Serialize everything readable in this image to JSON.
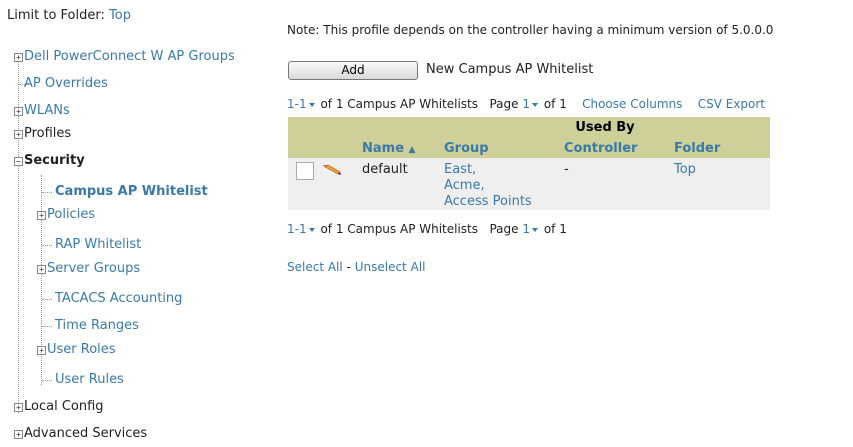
{
  "limit": {
    "label": "Limit to Folder:",
    "folder": "Top"
  },
  "tree": {
    "items": [
      {
        "label": "Dell PowerConnect W AP Groups"
      },
      {
        "label": "AP Overrides"
      },
      {
        "label": "WLANs"
      },
      {
        "label": "Profiles"
      },
      {
        "label": "Security"
      },
      {
        "label": "Campus AP Whitelist"
      },
      {
        "label": "Policies"
      },
      {
        "label": "RAP Whitelist"
      },
      {
        "label": "Server Groups"
      },
      {
        "label": "TACACS Accounting"
      },
      {
        "label": "Time Ranges"
      },
      {
        "label": "User Roles"
      },
      {
        "label": "User Rules"
      },
      {
        "label": "Local Config"
      },
      {
        "label": "Advanced Services"
      }
    ]
  },
  "note": "Note: This profile depends on the controller having a minimum version of 5.0.0.0",
  "add_button": "Add",
  "add_caption": "New Campus AP Whitelist",
  "pager_top": {
    "range": "1-1",
    "text": "of 1 Campus AP Whitelists",
    "page_label": "Page",
    "page": "1",
    "of_pages": "of 1",
    "choose_columns": "Choose Columns",
    "csv_export": "CSV Export"
  },
  "table": {
    "group_header": "Used By",
    "columns": {
      "name": "Name",
      "group": "Group",
      "controller": "Controller",
      "folder": "Folder"
    },
    "row": {
      "name": "default",
      "groups": [
        "East,",
        "Acme,",
        "Access Points"
      ],
      "controller": "-",
      "folder": "Top"
    }
  },
  "pager_bottom": {
    "range": "1-1",
    "text": "of 1 Campus AP Whitelists",
    "page_label": "Page",
    "page": "1",
    "of_pages": "of 1"
  },
  "selection": {
    "select_all": "Select All",
    "separator": "-",
    "unselect_all": "Unselect All"
  },
  "icons": {
    "edit": "pencil-icon",
    "expand": "plus-box-icon",
    "collapse": "minus-box-icon"
  },
  "colors": {
    "link": "#3a7aa8",
    "header_bg": "#cfcf9a",
    "row_bg": "#efefef"
  }
}
